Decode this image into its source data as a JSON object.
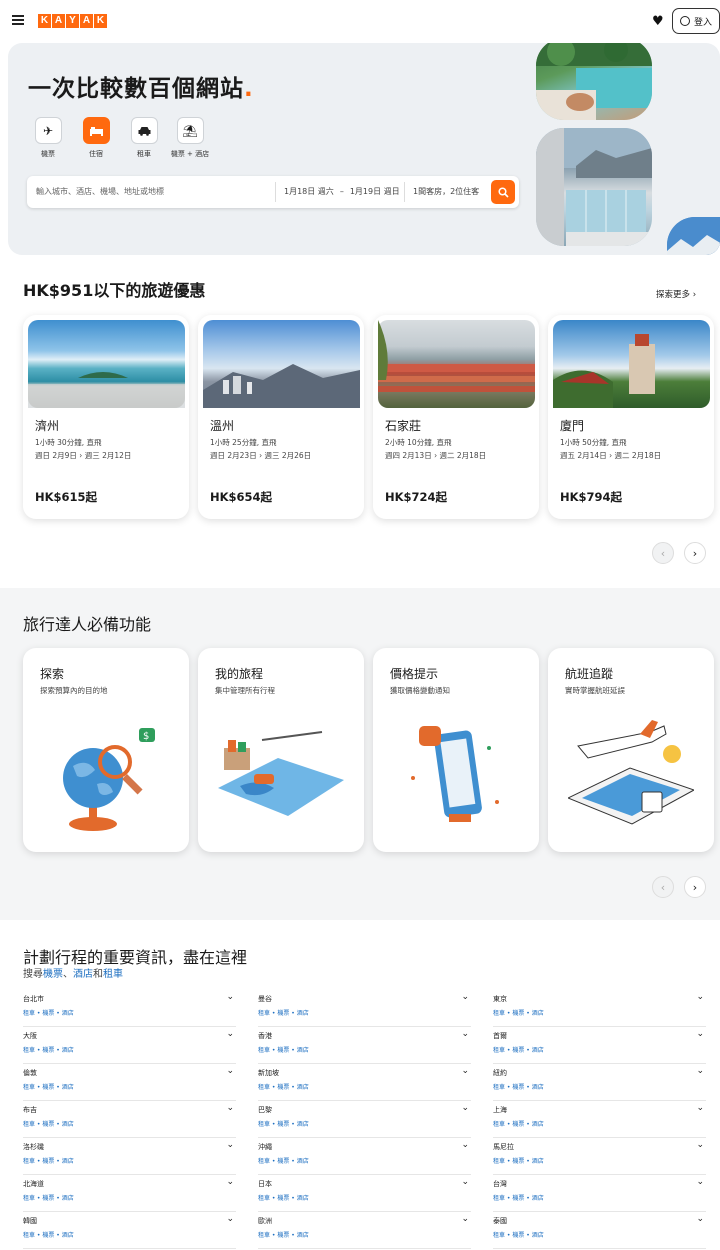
{
  "header": {
    "logo_letters": [
      "K",
      "A",
      "Y",
      "A",
      "K"
    ],
    "login_label": "登入"
  },
  "hero": {
    "title": "一次比較數百個網站",
    "title_dot": ".",
    "verticals": [
      {
        "label": "機票",
        "icon": "plane-icon",
        "glyph": "✈"
      },
      {
        "label": "住宿",
        "icon": "bed-icon",
        "glyph": "▬"
      },
      {
        "label": "租車",
        "icon": "car-icon",
        "glyph": "🚗"
      },
      {
        "label": "機票 + 酒店",
        "icon": "beach-umbrella-icon",
        "glyph": "⛱"
      }
    ],
    "search": {
      "destination_placeholder": "輸入城市、酒店、機場、地址或地標",
      "checkin": "1月18日 週六",
      "date_sep": "–",
      "checkout": "1月19日 週日",
      "guests": "1間客房，2位住客"
    }
  },
  "deals": {
    "heading": "HK$951以下的旅遊優惠",
    "explore_more": "探索更多",
    "cards": [
      {
        "city": "濟州",
        "duration": "1小時 30分鐘, 直飛",
        "dates": "週日 2月9日 › 週三 2月12日",
        "price": "HK$615起"
      },
      {
        "city": "溫州",
        "duration": "1小時 25分鐘, 直飛",
        "dates": "週日 2月23日 › 週三 2月26日",
        "price": "HK$654起"
      },
      {
        "city": "石家莊",
        "duration": "2小時 10分鐘, 直飛",
        "dates": "週四 2月13日 › 週二 2月18日",
        "price": "HK$724起"
      },
      {
        "city": "廈門",
        "duration": "1小時 50分鐘, 直飛",
        "dates": "週五 2月14日 › 週二 2月18日",
        "price": "HK$794起"
      }
    ]
  },
  "features": {
    "heading": "旅行達人必備功能",
    "cards": [
      {
        "title": "探索",
        "subtitle": "探索預算內的目的地"
      },
      {
        "title": "我的旅程",
        "subtitle": "集中管理所有行程"
      },
      {
        "title": "價格提示",
        "subtitle": "獲取價格變動通知"
      },
      {
        "title": "航班追蹤",
        "subtitle": "實時掌握航班延誤"
      }
    ]
  },
  "info": {
    "heading": "計劃行程的重要資訊，盡在這裡",
    "sub_prefix": "搜尋",
    "sub_link1": "機票",
    "sub_sep": "、",
    "sub_link2": "酒店",
    "sub_and": "和",
    "sub_link3": "租車",
    "links_text": "租車 • 機票 • 酒店",
    "columns": [
      [
        "台北市",
        "大阪",
        "倫敦",
        "布吉",
        "洛杉磯",
        "北海道",
        "韓國"
      ],
      [
        "曼谷",
        "香港",
        "新加坡",
        "巴黎",
        "沖繩",
        "日本",
        "歐洲"
      ],
      [
        "東京",
        "首爾",
        "紐約",
        "上海",
        "馬尼拉",
        "台灣",
        "泰國"
      ]
    ]
  }
}
